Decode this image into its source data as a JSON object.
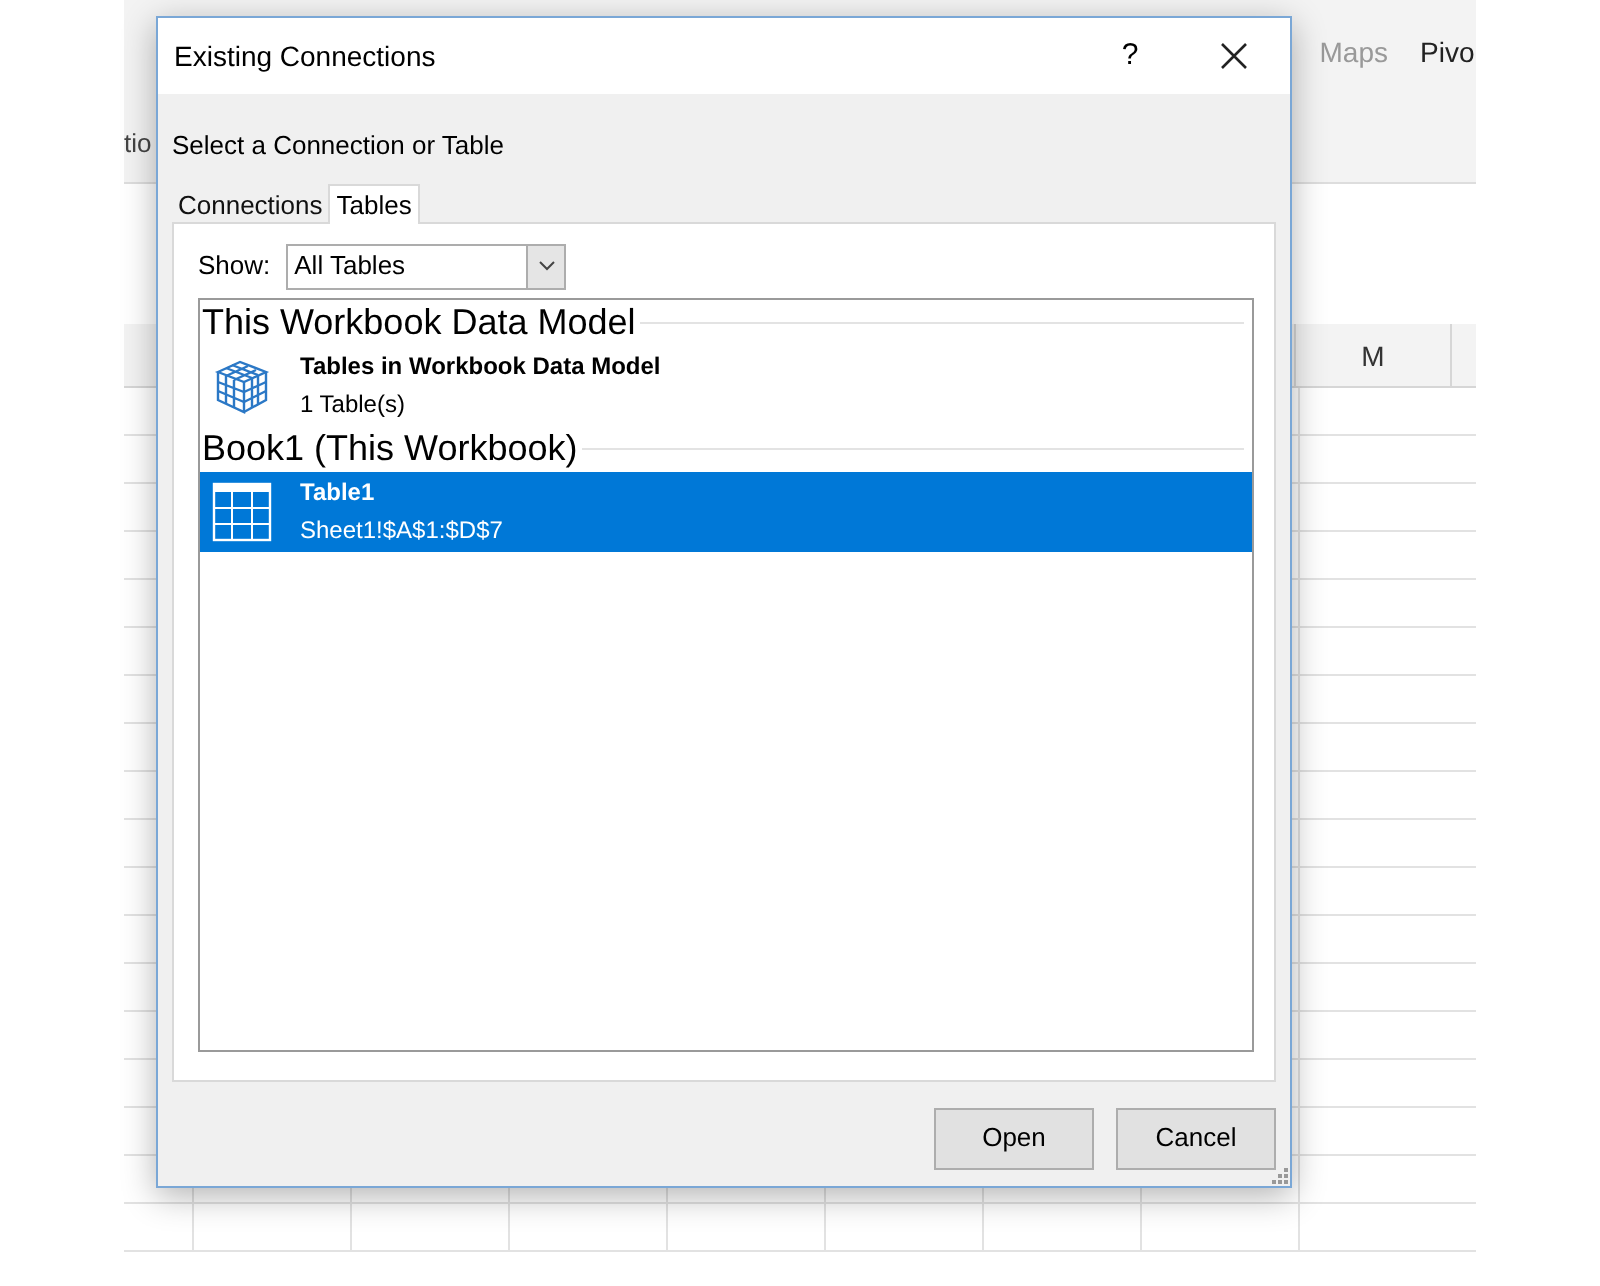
{
  "background": {
    "ribbon_left": "tio",
    "ribbon_buttons": [
      "Maps",
      "Pivo"
    ],
    "column_header": "M"
  },
  "window": {
    "title": "Existing Connections",
    "help": "?"
  },
  "prompt": "Select a Connection or Table",
  "tabs": [
    {
      "label": "Connections",
      "selected": false
    },
    {
      "label": "Tables",
      "selected": true
    }
  ],
  "show": {
    "label": "Show:",
    "value": "All Tables"
  },
  "groups": [
    {
      "title": "This Workbook Data Model",
      "items": [
        {
          "kind": "model",
          "name": "Tables in Workbook Data Model",
          "detail": "1 Table(s)",
          "selected": false
        }
      ]
    },
    {
      "title": "Book1 (This Workbook)",
      "items": [
        {
          "kind": "table",
          "name": "Table1",
          "detail": "Sheet1!$A$1:$D$7",
          "selected": true
        }
      ]
    }
  ],
  "buttons": [
    "Open",
    "Cancel"
  ]
}
